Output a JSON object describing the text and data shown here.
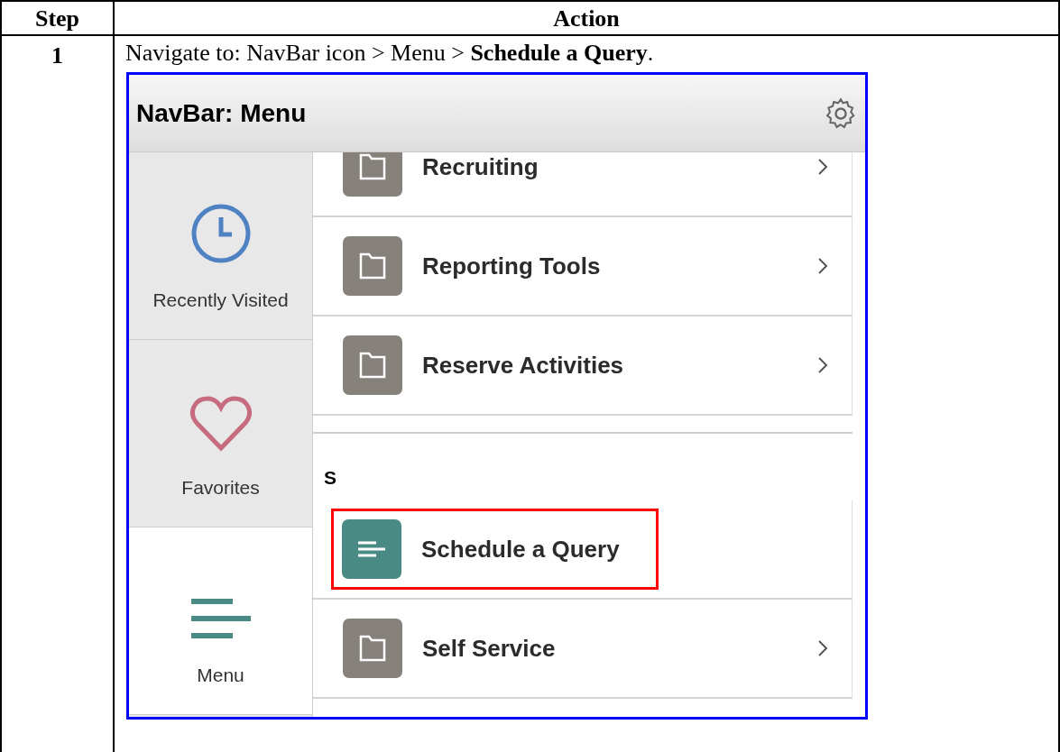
{
  "table": {
    "columns": [
      "Step",
      "Action"
    ],
    "rows": [
      {
        "step": "1",
        "instruction": "Navigate to: NavBar icon > Menu > **Schedule a Query**.",
        "screenshot": {
          "title": "NavBar: Menu",
          "sidebar": [
            {
              "label": "Recently Visited",
              "kind": "clock",
              "selected": false
            },
            {
              "label": "Favorites",
              "kind": "heart",
              "selected": false
            },
            {
              "label": "Menu",
              "kind": "menu",
              "selected": true
            }
          ],
          "items": [
            {
              "kind": "folder",
              "label": "Recruiting",
              "highlighted": false
            },
            {
              "kind": "folder",
              "label": "Reporting Tools",
              "highlighted": false
            },
            {
              "kind": "folder",
              "label": "Reserve Activities",
              "highlighted": false
            },
            {
              "kind": "section",
              "label": "S"
            },
            {
              "kind": "link",
              "label": "Schedule a Query",
              "highlighted": true
            },
            {
              "kind": "folder",
              "label": "Self Service",
              "highlighted": false
            }
          ]
        }
      }
    ]
  }
}
